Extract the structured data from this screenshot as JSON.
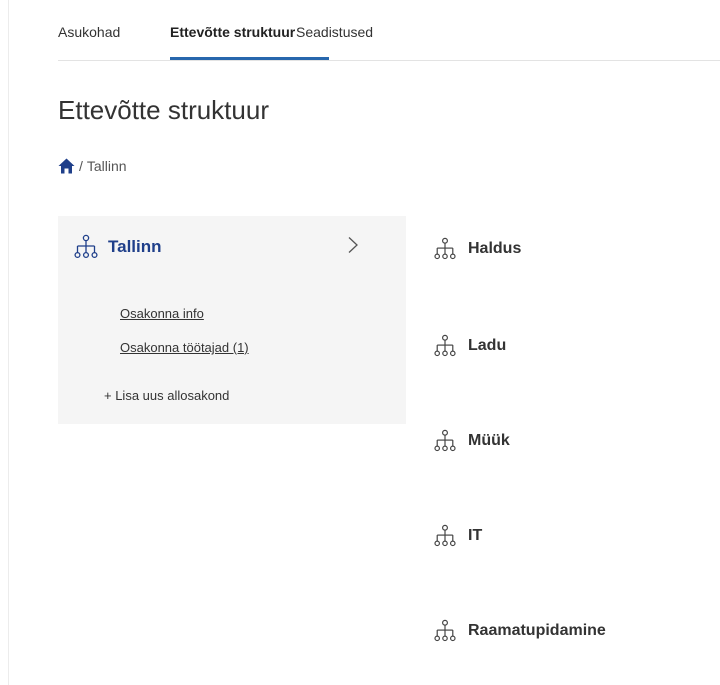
{
  "tabs": [
    {
      "label": "Asukohad",
      "active": false
    },
    {
      "label": "Ettevõtte struktuur",
      "active": true
    },
    {
      "label": "Seadistused",
      "active": false
    }
  ],
  "colors": {
    "accent": "#2767ad",
    "card_title": "#1f3f8a",
    "card_bg": "#f5f5f5"
  },
  "page": {
    "title": "Ettevõtte struktuur"
  },
  "breadcrumb": {
    "home_icon": "home-icon",
    "separator": "/",
    "current": "Tallinn"
  },
  "selected_unit": {
    "icon": "org-chart-icon",
    "title": "Tallinn",
    "chevron_icon": "chevron-right-icon",
    "links": [
      {
        "label": "Osakonna info"
      },
      {
        "label": "Osakonna töötajad (1)"
      }
    ],
    "add_label": "+ Lisa uus allosakond"
  },
  "subunits": [
    {
      "label": "Haldus"
    },
    {
      "label": "Ladu"
    },
    {
      "label": "Müük"
    },
    {
      "label": "IT"
    },
    {
      "label": "Raamatupidamine"
    }
  ]
}
